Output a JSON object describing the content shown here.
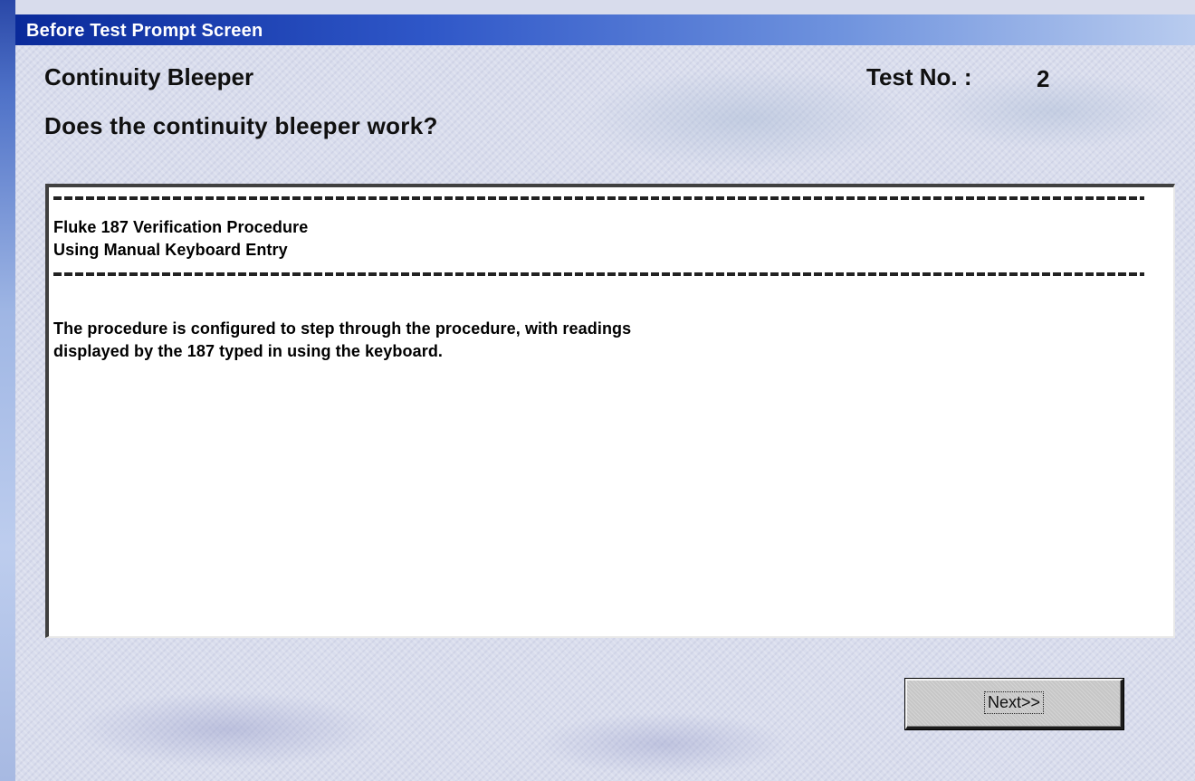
{
  "window": {
    "title": "Before Test Prompt Screen"
  },
  "header": {
    "test_name": "Continuity Bleeper",
    "test_no_label": "Test No. :",
    "test_no_value": "2",
    "question": "Does the continuity bleeper work?"
  },
  "panel": {
    "line_title": "Fluke 187 Verification Procedure",
    "line_subtitle": "Using Manual Keyboard Entry",
    "body_line_1": "The procedure is configured to step through the procedure, with readings",
    "body_line_2": "displayed by the 187 typed in using the keyboard."
  },
  "buttons": {
    "next_label": "Next>>"
  },
  "colors": {
    "titlebar_start": "#0a2a9a",
    "titlebar_end": "#b9ccef",
    "client_bg": "#d9dded",
    "panel_bg": "#ffffff",
    "button_face": "#c6c6c6"
  }
}
